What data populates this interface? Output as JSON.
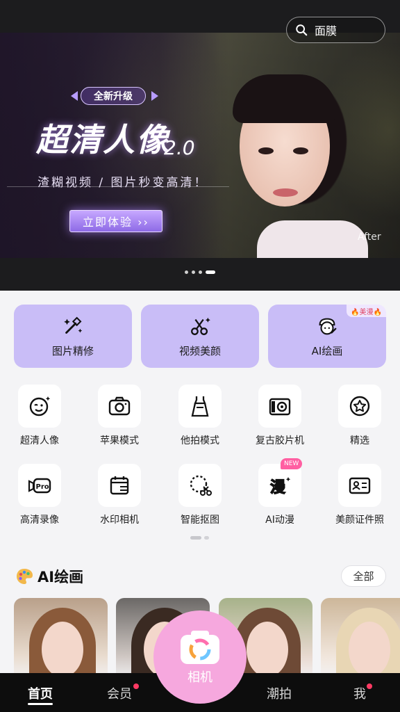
{
  "search": {
    "icon": "search-icon",
    "text": "面膜"
  },
  "banner": {
    "tag": "全新升级",
    "title": "超清人像",
    "version": "2.0",
    "subtitle": "渣糊视频 / 图片秒变高清！",
    "cta": "立即体验 ››",
    "after": "After",
    "page_indicator": {
      "count": 4,
      "active": 3
    }
  },
  "features": [
    {
      "label": "图片精修",
      "icon": "magic-wand-icon"
    },
    {
      "label": "视频美颜",
      "icon": "scissors-icon"
    },
    {
      "label": "AI绘画",
      "icon": "ai-paint-icon",
      "badge": "🔥美漫🔥"
    }
  ],
  "tools_row1": [
    {
      "label": "超清人像",
      "icon": "wink-face-icon"
    },
    {
      "label": "苹果模式",
      "icon": "camera-icon"
    },
    {
      "label": "他拍模式",
      "icon": "dress-icon"
    },
    {
      "label": "复古胶片机",
      "icon": "film-camera-icon"
    },
    {
      "label": "精选",
      "icon": "star-icon"
    }
  ],
  "tools_row2": [
    {
      "label": "高清录像",
      "icon": "pro-video-icon"
    },
    {
      "label": "水印相机",
      "icon": "watermark-calendar-icon"
    },
    {
      "label": "智能抠图",
      "icon": "cutout-icon"
    },
    {
      "label": "AI动漫",
      "icon": "ai-anime-icon",
      "badge": "NEW"
    },
    {
      "label": "美颜证件照",
      "icon": "id-card-icon"
    }
  ],
  "section": {
    "title": "AI绘画",
    "icon": "palette-icon",
    "all": "全部"
  },
  "nav": {
    "home": "首页",
    "vip": "会员",
    "camera": "相机",
    "trend": "潮拍",
    "me": "我"
  },
  "colors": {
    "accent": "#c9bdf7",
    "camera": "#f6a8de",
    "badge": "#ff5fa2",
    "dot": "#ff3a63"
  }
}
